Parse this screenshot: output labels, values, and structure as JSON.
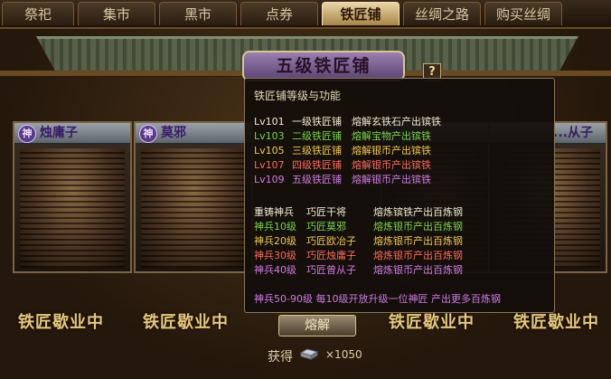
{
  "tabs": [
    {
      "label": "祭祀",
      "active": false
    },
    {
      "label": "集市",
      "active": false
    },
    {
      "label": "黑市",
      "active": false
    },
    {
      "label": "点券",
      "active": false
    },
    {
      "label": "铁匠铺",
      "active": true
    },
    {
      "label": "丝绸之路",
      "active": false
    },
    {
      "label": "购买丝绸",
      "active": false
    }
  ],
  "header": {
    "title": "五级铁匠铺",
    "help": "?"
  },
  "cards": [
    {
      "seal": "神",
      "name": "烛庸子",
      "status": "铁匠歇业中"
    },
    {
      "seal": "神",
      "name": "莫邪",
      "status": "铁匠歇业中"
    },
    {
      "seal": "神",
      "name": "...从子",
      "status": "铁匠歇业中"
    },
    {
      "seal": "神",
      "name": "",
      "status": "铁匠歇业中"
    }
  ],
  "center": {
    "smelt_label": "熔解",
    "gain_label": "获得",
    "gain_icon": "iron-ingot-icon",
    "gain_qty": "×1050"
  },
  "tooltip": {
    "title": "铁匠铺等级与功能",
    "levels": [
      {
        "lv": "Lv101",
        "name": "一级铁匠铺",
        "effect": "熔解玄铁石产出镔铁",
        "color": "white"
      },
      {
        "lv": "Lv103",
        "name": "二级铁匠铺",
        "effect": "熔解宝物产出镔铁",
        "color": "green"
      },
      {
        "lv": "Lv105",
        "name": "三级铁匠铺",
        "effect": "熔解银币产出镔铁",
        "color": "yellow"
      },
      {
        "lv": "Lv107",
        "name": "四级铁匠铺",
        "effect": "熔解银币产出镔铁",
        "color": "red"
      },
      {
        "lv": "Lv109",
        "name": "五级铁匠铺",
        "effect": "熔解银币产出镔铁",
        "color": "purple"
      }
    ],
    "smiths": [
      {
        "tier": "重铸神兵",
        "smith": "巧匠干将",
        "effect": "熔炼镔铁产出百炼钢",
        "color": "white"
      },
      {
        "tier": "神兵10级",
        "smith": "巧匠莫邪",
        "effect": "熔炼银币产出百炼钢",
        "color": "green"
      },
      {
        "tier": "神兵20级",
        "smith": "巧匠欧冶子",
        "effect": "熔炼银币产出百炼钢",
        "color": "yellow"
      },
      {
        "tier": "神兵30级",
        "smith": "巧匠烛庸子",
        "effect": "熔炼银币产出百炼钢",
        "color": "red"
      },
      {
        "tier": "神兵40级",
        "smith": "巧匠曾从子",
        "effect": "熔炼银币产出百炼钢",
        "color": "purple"
      }
    ],
    "footer": "神兵50-90级  每10级开放升级一位神匠  产出更多百炼钢"
  },
  "colors": {
    "white": "#f1ead4",
    "green": "#79d64a",
    "yellow": "#f2c94a",
    "red": "#ff6a5a",
    "purple": "#d07ae8",
    "accent": "#c9a86a"
  }
}
